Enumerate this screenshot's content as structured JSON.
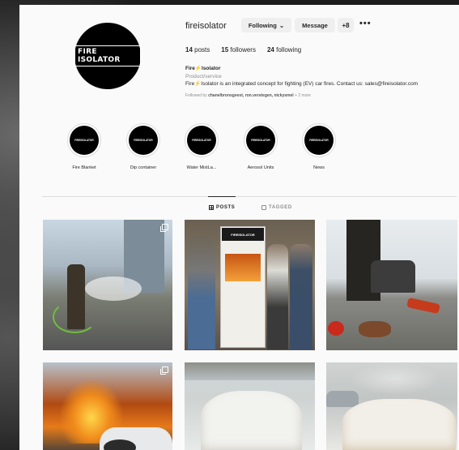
{
  "profile": {
    "username": "fireisolator",
    "following_label": "Following",
    "message_label": "Message",
    "add_user_glyph": "+8",
    "more_glyph": "•••",
    "avatar_text": "FIRE ISOLATOR"
  },
  "stats": {
    "posts_count": "14",
    "posts_label": "posts",
    "followers_count": "15",
    "followers_label": "followers",
    "following_count": "24",
    "following_label": "following"
  },
  "bio": {
    "name_pre": "Fire",
    "name_post": "Isolator",
    "category": "Product/service",
    "text_pre": "Fire",
    "text_post": "Isolator is an integrated concept for fighting (EV) car fires. Contact us: sales@fireisolator.com",
    "flash_glyph": "⚡"
  },
  "followed_by": {
    "prefix": "Followed by ",
    "names": "chanelbronsgeest, ron.verstegen, nickysmel",
    "suffix": " + 2 more"
  },
  "highlights": [
    {
      "label": "Fire Blanket",
      "logo": "FIREISOLATOR"
    },
    {
      "label": "Dip container",
      "logo": "FIREISOLATOR"
    },
    {
      "label": "Water MistLa...",
      "logo": "FIREISOLATOR"
    },
    {
      "label": "Aerosol Units",
      "logo": "FIREISOLATOR"
    },
    {
      "label": "News",
      "logo": "FIREISOLATOR"
    }
  ],
  "tabs": {
    "posts": "POSTS",
    "tagged": "TAGGED"
  },
  "posts": {
    "p2_banner": "FIREISOLATOR"
  },
  "icons": {
    "chevron": "chevron-down-icon",
    "multi": "multiple-images-icon"
  }
}
